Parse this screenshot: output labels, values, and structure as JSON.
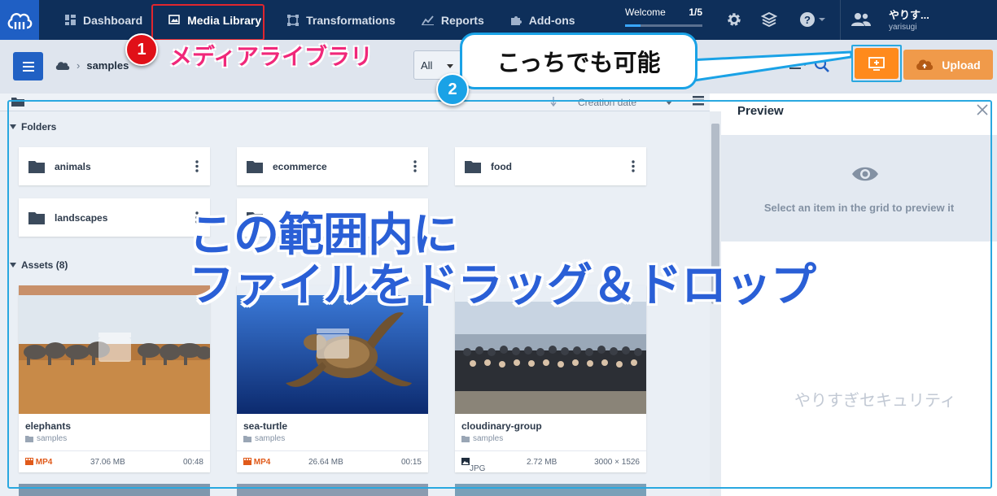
{
  "topbar": {
    "nav": [
      {
        "label": "Dashboard",
        "icon": "dashboard-icon"
      },
      {
        "label": "Media Library",
        "icon": "media-library-icon",
        "active": true
      },
      {
        "label": "Transformations",
        "icon": "transformations-icon"
      },
      {
        "label": "Reports",
        "icon": "reports-icon"
      },
      {
        "label": "Add-ons",
        "icon": "puzzle-icon"
      }
    ],
    "welcome": {
      "label": "Welcome",
      "count": "1/5",
      "progress": 0.2
    },
    "icons": [
      "gear-icon",
      "layers-icon",
      "help-icon"
    ],
    "user": {
      "name": "やりす...",
      "id": "yarisugi"
    }
  },
  "toolbar": {
    "breadcrumb": "samples",
    "filter": "All",
    "upload_label": "Upload"
  },
  "grid": {
    "sort_label": "Creation date",
    "folders_label": "Folders",
    "folders": [
      "animals",
      "ecommerce",
      "food",
      "landscapes",
      ""
    ],
    "assets_label": "Assets (8)",
    "assets": [
      {
        "title": "elephants",
        "folder": "samples",
        "format": "MP4",
        "size": "37.06 MB",
        "meta": "00:48",
        "kind": "video"
      },
      {
        "title": "sea-turtle",
        "folder": "samples",
        "format": "MP4",
        "size": "26.64 MB",
        "meta": "00:15",
        "kind": "video"
      },
      {
        "title": "cloudinary-group",
        "folder": "samples",
        "format": "JPG",
        "size": "2.72 MB",
        "meta": "3000 × 1526",
        "kind": "image"
      }
    ]
  },
  "preview": {
    "title": "Preview",
    "message": "Select an item in the grid to preview it"
  },
  "annotations": {
    "badge1": "1",
    "label1": "メディアライブラリ",
    "badge2": "2",
    "callout": "こっちでも可能",
    "drop_line1": "この範囲内に",
    "drop_line2": "ファイルをドラッグ＆ドロップ",
    "watermark": "やりすぎセキュリティ"
  },
  "colors": {
    "topbar": "#0e2f5a",
    "accent_blue": "#2161c4",
    "orange": "#ff8a1c",
    "annotation_red": "#e01018",
    "annotation_pink": "#f0287a",
    "annotation_cyan": "#1aa2e6"
  }
}
